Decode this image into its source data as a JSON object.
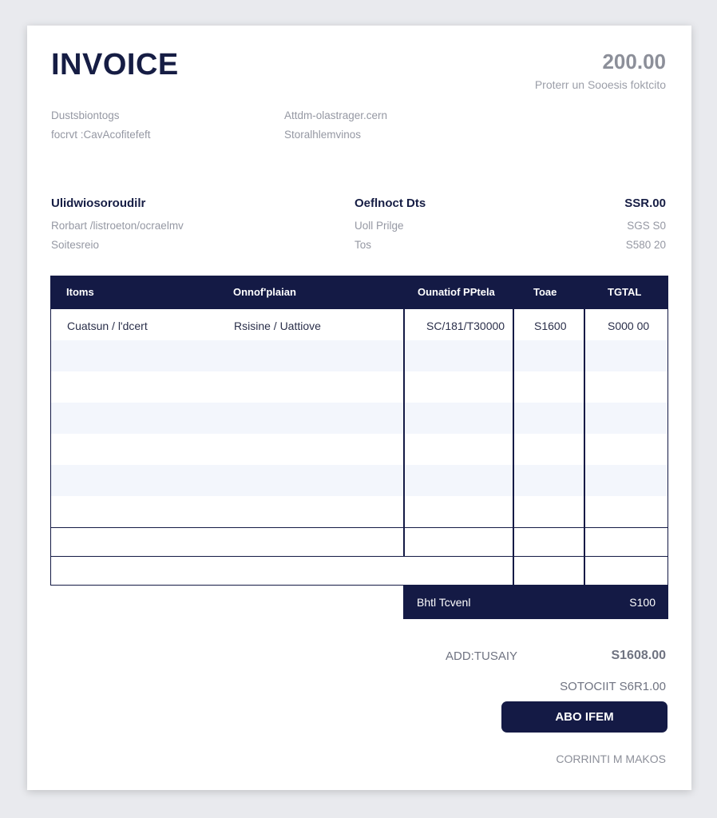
{
  "header": {
    "title": "INVOICE",
    "amount": "200.00",
    "amount_sub": "Proterr un Sooesis foktcito"
  },
  "info": {
    "left_line1": "Dustsbiontogs",
    "left_line2": "focrvt :CavAcofitefeft",
    "right_line1": "Attdm-olastrager.cern",
    "right_line2": "Storalhlemvinos"
  },
  "details": {
    "left_heading": "Ulidwiosoroudilr",
    "left_line1": "Rorbart /listroeton/ocraelmv",
    "left_line2": "Soitesreio",
    "mid_heading": "Oeflnoct Dts",
    "mid_line1": "Uoll Prilge",
    "mid_line2": "Tos",
    "right_heading": "SSR.00",
    "right_line1": "SGS S0",
    "right_line2": "S580 20"
  },
  "table": {
    "headers": [
      "Itoms",
      "Onnof'plaian",
      "Ounatiof PPtela",
      "Toae",
      "TGTAL"
    ],
    "rows": [
      [
        "Cuatsun / l'dcert",
        "Rsisine / Uattiove",
        "SC/181/T30000",
        "S1600",
        "S000 00"
      ]
    ],
    "total_label": "Bhtl Tcvenl",
    "total_value": "S100"
  },
  "summary": {
    "line1_label": "ADD:TUSAIY",
    "line1_value": "S1608.00",
    "line2_text": "SOTOCIIT S6R1.00",
    "add_button": "ABO IFEM",
    "footer": "CORRINTI M MAKOS"
  },
  "colors": {
    "navy": "#141a45",
    "muted": "#9598a3",
    "stripe": "#f3f6fc"
  }
}
